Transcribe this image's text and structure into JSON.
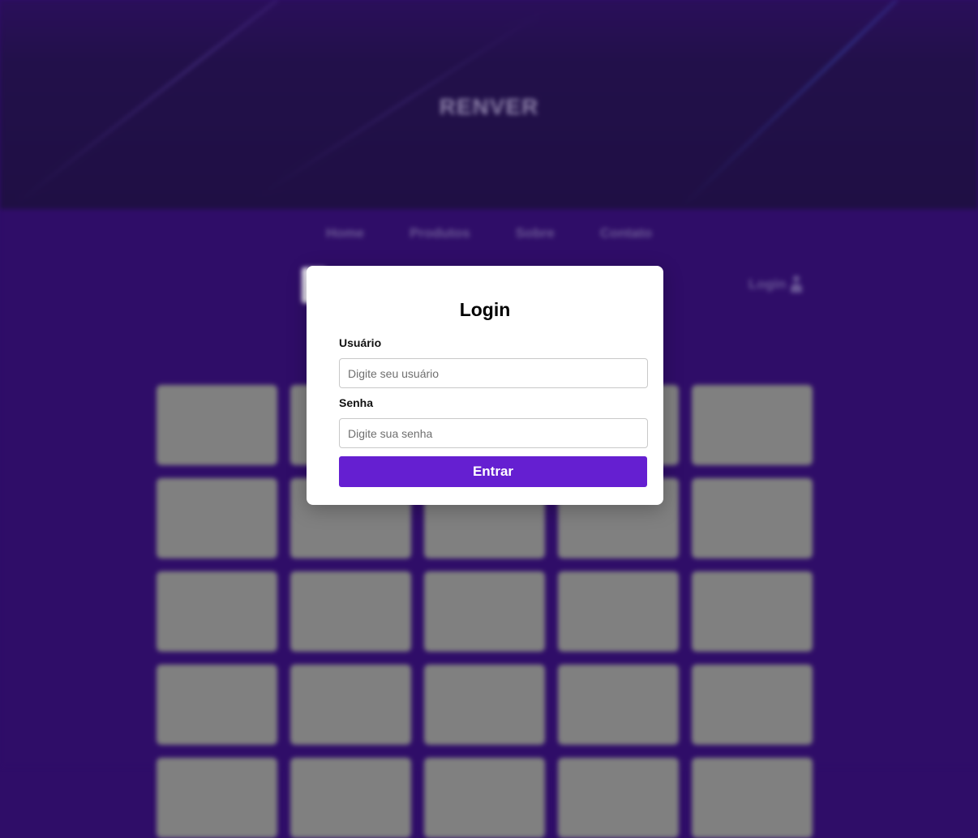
{
  "background": {
    "brand": "RENVER",
    "nav": [
      "Home",
      "Produtos",
      "Sobre",
      "Contato"
    ],
    "login_link": "Login",
    "login_icon": "user-icon",
    "grid_rows_visible": 5,
    "grid_columns": 5
  },
  "modal": {
    "title": "Login",
    "username_label": "Usuário",
    "username_placeholder": "Digite seu usuário",
    "username_value": "",
    "password_label": "Senha",
    "password_placeholder": "Digite sua senha",
    "password_value": "",
    "submit_label": "Entrar"
  },
  "colors": {
    "page_background": "#2f0d68",
    "hero_background": "#22104a",
    "card_placeholder": "#808080",
    "primary_button": "#651fd1",
    "modal_background": "#ffffff"
  }
}
